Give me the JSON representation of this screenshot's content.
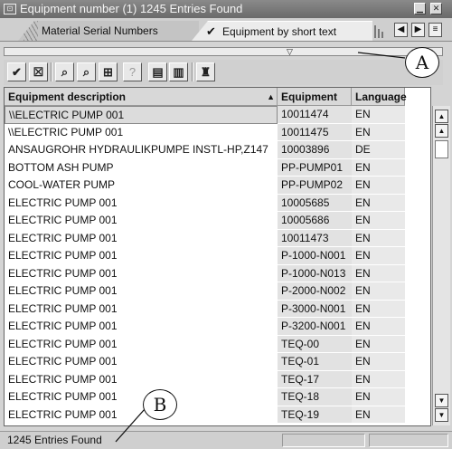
{
  "window": {
    "title": "Equipment number (1) 1245 Entries Found",
    "icon": "window-menu-icon"
  },
  "tabs": [
    {
      "label": "Material Serial Numbers",
      "active": false
    },
    {
      "label": "Equipment by short text",
      "active": true
    }
  ],
  "toolbar": {
    "icons": [
      "checkmark-icon",
      "cancel-icon",
      "find-icon",
      "find-next-icon",
      "export-icon",
      "help-icon",
      "print-icon",
      "broom-icon"
    ]
  },
  "table": {
    "columns": [
      "Equipment description",
      "Equipment",
      "Language"
    ],
    "rows": [
      [
        "\\\\ELECTRIC PUMP 001",
        "10011474",
        "EN"
      ],
      [
        "\\\\ELECTRIC PUMP 001",
        "10011475",
        "EN"
      ],
      [
        "ANSAUGROHR HYDRAULIKPUMPE INSTL-HP,Z147",
        "10003896",
        "DE"
      ],
      [
        "BOTTOM ASH PUMP",
        "PP-PUMP01",
        "EN"
      ],
      [
        "COOL-WATER PUMP",
        "PP-PUMP02",
        "EN"
      ],
      [
        "ELECTRIC PUMP 001",
        "10005685",
        "EN"
      ],
      [
        "ELECTRIC PUMP 001",
        "10005686",
        "EN"
      ],
      [
        "ELECTRIC PUMP 001",
        "10011473",
        "EN"
      ],
      [
        "ELECTRIC PUMP 001",
        "P-1000-N001",
        "EN"
      ],
      [
        "ELECTRIC PUMP 001",
        "P-1000-N013",
        "EN"
      ],
      [
        "ELECTRIC PUMP 001",
        "P-2000-N002",
        "EN"
      ],
      [
        "ELECTRIC PUMP 001",
        "P-3000-N001",
        "EN"
      ],
      [
        "ELECTRIC PUMP 001",
        "P-3200-N001",
        "EN"
      ],
      [
        "ELECTRIC PUMP 001",
        "TEQ-00",
        "EN"
      ],
      [
        "ELECTRIC PUMP 001",
        "TEQ-01",
        "EN"
      ],
      [
        "ELECTRIC PUMP 001",
        "TEQ-17",
        "EN"
      ],
      [
        "ELECTRIC PUMP 001",
        "TEQ-18",
        "EN"
      ],
      [
        "ELECTRIC PUMP 001",
        "TEQ-19",
        "EN"
      ]
    ]
  },
  "status": {
    "text": "1245 Entries Found"
  },
  "callouts": [
    "A",
    "B"
  ]
}
